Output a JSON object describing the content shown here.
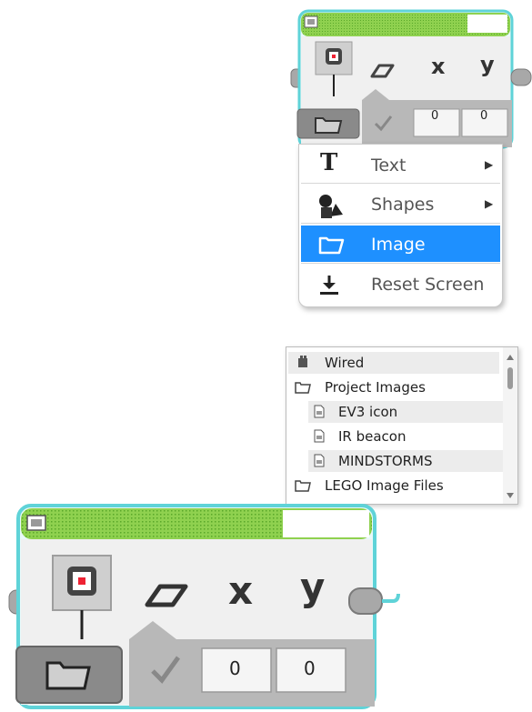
{
  "block_small": {
    "x_label": "x",
    "y_label": "y",
    "x_value": "0",
    "y_value": "0"
  },
  "menu": {
    "items": [
      {
        "label": "Text",
        "icon": "text-T-icon",
        "has_submenu": true
      },
      {
        "label": "Shapes",
        "icon": "shapes-icon",
        "has_submenu": true
      },
      {
        "label": "Image",
        "icon": "folder-icon",
        "has_submenu": false,
        "selected": true
      },
      {
        "label": "Reset Screen",
        "icon": "download-arrow-icon",
        "has_submenu": false
      }
    ],
    "submenu_arrow": "▶",
    "highlight_color": "#1e90ff"
  },
  "file_list": {
    "items": [
      {
        "label": "Wired",
        "icon": "brick-icon",
        "indent": 0
      },
      {
        "label": "Project Images",
        "icon": "folder-icon",
        "indent": 0
      },
      {
        "label": "EV3 icon",
        "icon": "image-file-icon",
        "indent": 1
      },
      {
        "label": "IR beacon",
        "icon": "image-file-icon",
        "indent": 1
      },
      {
        "label": "MINDSTORMS",
        "icon": "image-file-icon",
        "indent": 1
      },
      {
        "label": "LEGO Image Files",
        "icon": "folder-icon",
        "indent": 0
      }
    ]
  },
  "block_large": {
    "x_label": "x",
    "y_label": "y",
    "x_value": "0",
    "y_value": "0"
  },
  "colors": {
    "block_green": "#7ac943",
    "block_border": "#4fd0d6",
    "block_body": "#f2f2f2",
    "param_gray": "#aaaaaa"
  }
}
